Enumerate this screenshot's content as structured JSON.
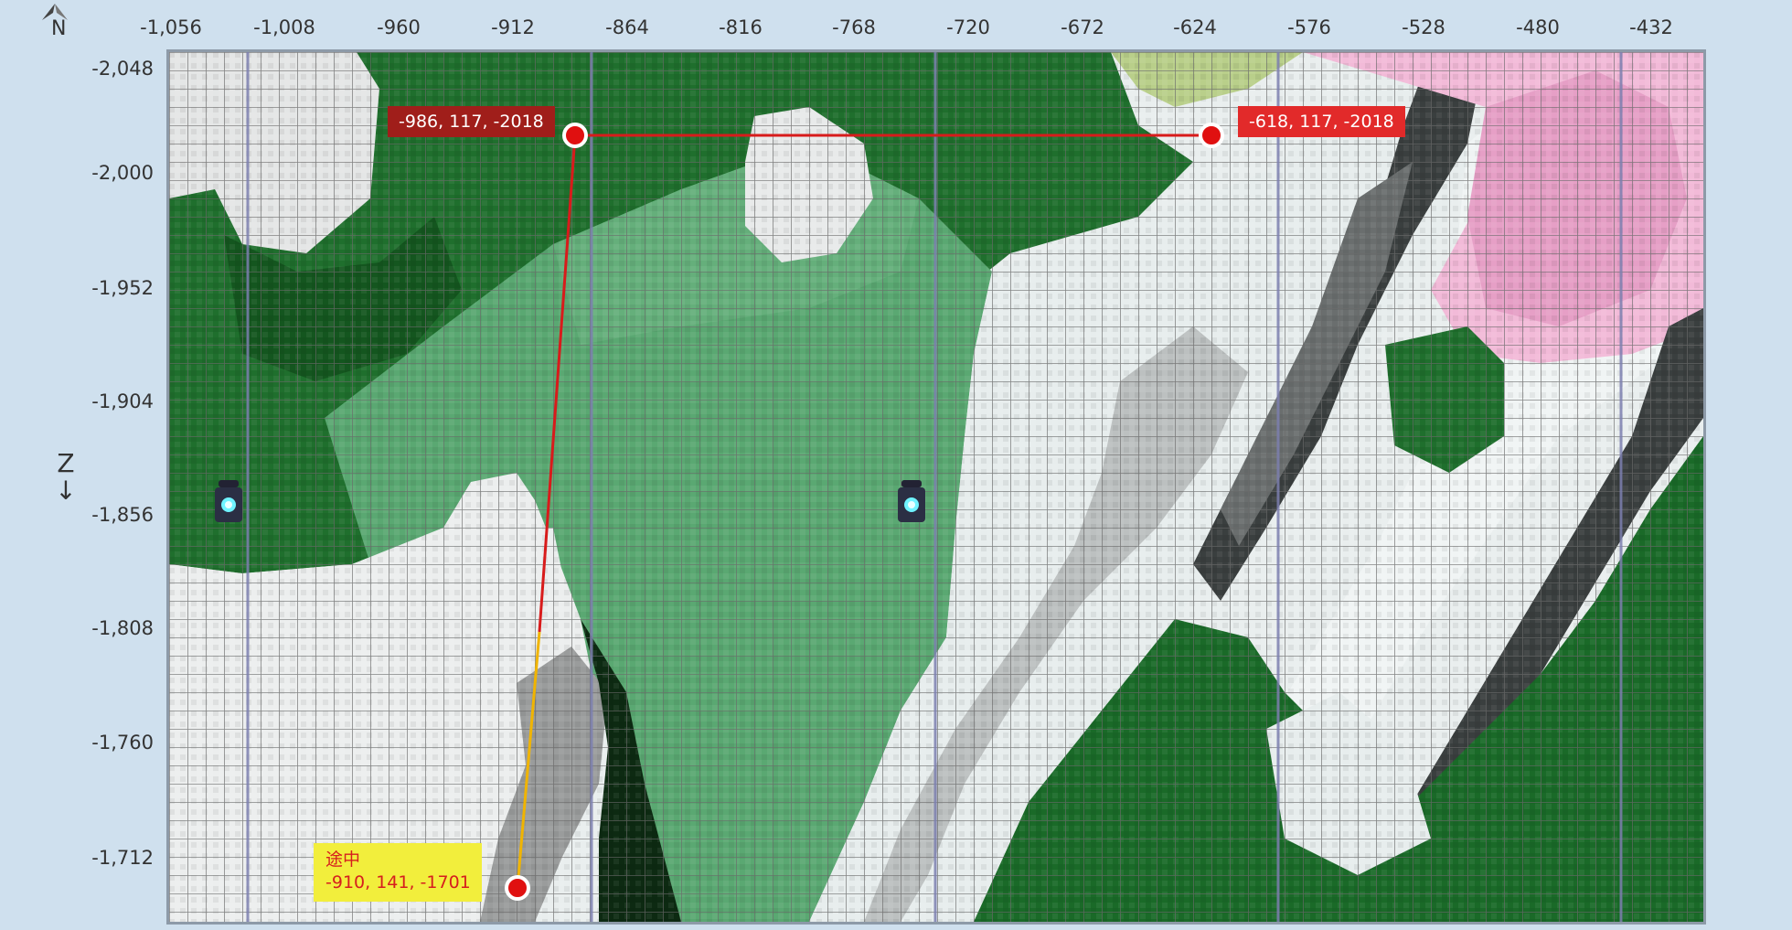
{
  "map": {
    "x_axis": {
      "ticks": [
        "-1,056",
        "-1,008",
        "-960",
        "-912",
        "-864",
        "-816",
        "-768",
        "-720",
        "-672",
        "-624",
        "-576",
        "-528",
        "-480",
        "-432"
      ]
    },
    "z_axis": {
      "label": "Z",
      "arrow": "↓",
      "ticks": [
        "-2,048",
        "-2,000",
        "-1,952",
        "-1,904",
        "-1,856",
        "-1,808",
        "-1,760",
        "-1,712"
      ]
    },
    "compass": {
      "label": "N",
      "icon": "north-arrow-icon"
    },
    "markers": {
      "start": {
        "label": "-986, 117, -2018"
      },
      "end": {
        "label": "-618, 117, -2018"
      },
      "midway": {
        "title": "途中",
        "coords": "-910, 141, -1701"
      }
    },
    "lantern_icon": "lantern-icon",
    "colors": {
      "route": "#d81b1b",
      "route_end_segment": "#f0b400",
      "marker": "#e01010",
      "grid": "#6a6a6a",
      "chunk_line": "#7d80b0",
      "background": "#cfe0ee"
    }
  }
}
